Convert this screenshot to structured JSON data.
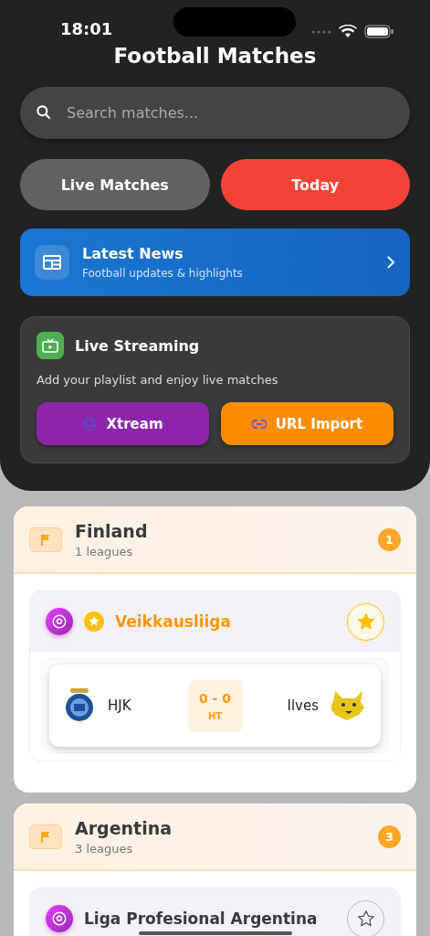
{
  "status_bar": {
    "time": "18:01"
  },
  "title": "Football Matches",
  "search": {
    "placeholder": "Search matches..."
  },
  "tabs": [
    {
      "label": "Live Matches",
      "selected": false
    },
    {
      "label": "Today",
      "selected": true
    }
  ],
  "news": {
    "title": "Latest News",
    "subtitle": "Football updates & highlights"
  },
  "streaming": {
    "title": "Live Streaming",
    "description": "Add your playlist and enjoy live matches",
    "buttons": [
      {
        "label": "Xtream",
        "kind": "xtream"
      },
      {
        "label": "URL Import",
        "kind": "url"
      }
    ]
  },
  "countries": [
    {
      "name": "Finland",
      "subtitle": "1 leagues",
      "count": "1",
      "leagues": [
        {
          "name": "Veikkausliiga",
          "favorite": true,
          "matches": [
            {
              "home": "HJK",
              "score": "0 - 0",
              "status": "HT",
              "away": "Ilves"
            }
          ]
        }
      ]
    },
    {
      "name": "Argentina",
      "subtitle": "3 leagues",
      "count": "3",
      "leagues": [
        {
          "name": "Liga Profesional Argentina",
          "favorite": false
        }
      ]
    }
  ]
}
